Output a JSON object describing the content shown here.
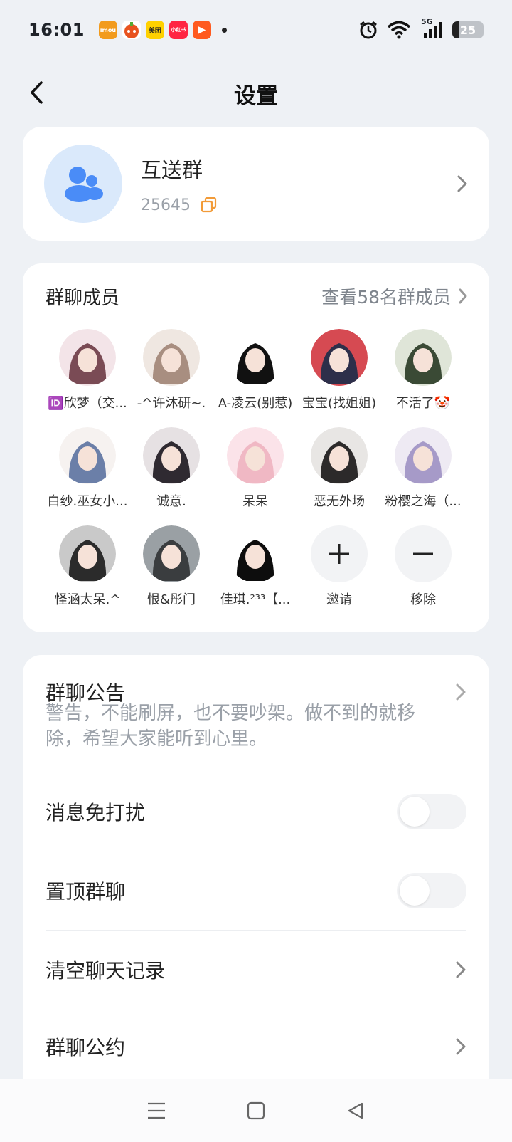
{
  "status_bar": {
    "time": "16:01",
    "network": "5G",
    "battery": "25",
    "apps": [
      {
        "name": "imou",
        "label": "imou",
        "color": "#f29b1d"
      },
      {
        "name": "cart",
        "label": "",
        "color": "#e8531f"
      },
      {
        "name": "meituan",
        "label": "美团",
        "color": "#ffd100"
      },
      {
        "name": "xiaohongshu",
        "label": "小红书",
        "color": "#ff2442"
      },
      {
        "name": "video",
        "label": "▶",
        "color": "#ff5a1f"
      }
    ]
  },
  "header": {
    "title": "设置"
  },
  "group": {
    "name": "互送群",
    "id": "25645"
  },
  "members": {
    "title": "群聊成员",
    "link": "查看58名群成员",
    "list": [
      {
        "name": "🆔欣梦（交...",
        "c1": "#f3e4e8",
        "c2": "#7a4b55"
      },
      {
        "name": "-^许沐研~.",
        "c1": "#efe7e1",
        "c2": "#a88e80"
      },
      {
        "name": "A-凌云(别惹)",
        "c1": "#ffffff",
        "c2": "#111111"
      },
      {
        "name": "宝宝(找姐姐)",
        "c1": "#d64a52",
        "c2": "#2d2f4a"
      },
      {
        "name": "不活了🤡",
        "c1": "#dfe5d8",
        "c2": "#3a4a35"
      },
      {
        "name": "白纱.巫女小...",
        "c1": "#f6f2f0",
        "c2": "#6b7fa8"
      },
      {
        "name": "诚意.",
        "c1": "#e6e1e3",
        "c2": "#2f2a31"
      },
      {
        "name": "呆呆",
        "c1": "#fbe3e9",
        "c2": "#f0b8c4"
      },
      {
        "name": "恶无外场",
        "c1": "#e8e6e4",
        "c2": "#2c2a2a"
      },
      {
        "name": "粉樱之海（...",
        "c1": "#eeeaf3",
        "c2": "#a69ac8"
      },
      {
        "name": "怪涵太呆.^",
        "c1": "#c9c9c9",
        "c2": "#2b2b2b"
      },
      {
        "name": "恨&彤门",
        "c1": "#9aa0a4",
        "c2": "#3a3d3f"
      },
      {
        "name": "佳琪.²³³【...",
        "c1": "#ffffff",
        "c2": "#0d0d0d"
      }
    ],
    "invite_label": "邀请",
    "remove_label": "移除"
  },
  "settings": {
    "notice_title": "群聊公告",
    "notice_text": "警告，不能刷屏，也不要吵架。做不到的就移除，希望大家能听到心里。",
    "mute_label": "消息免打扰",
    "mute_on": false,
    "pin_label": "置顶群聊",
    "pin_on": false,
    "clear_label": "清空聊天记录",
    "rules_label": "群聊公约"
  },
  "colors": {
    "accent_blue": "#4a8cf7",
    "copy_orange": "#f29b38"
  }
}
